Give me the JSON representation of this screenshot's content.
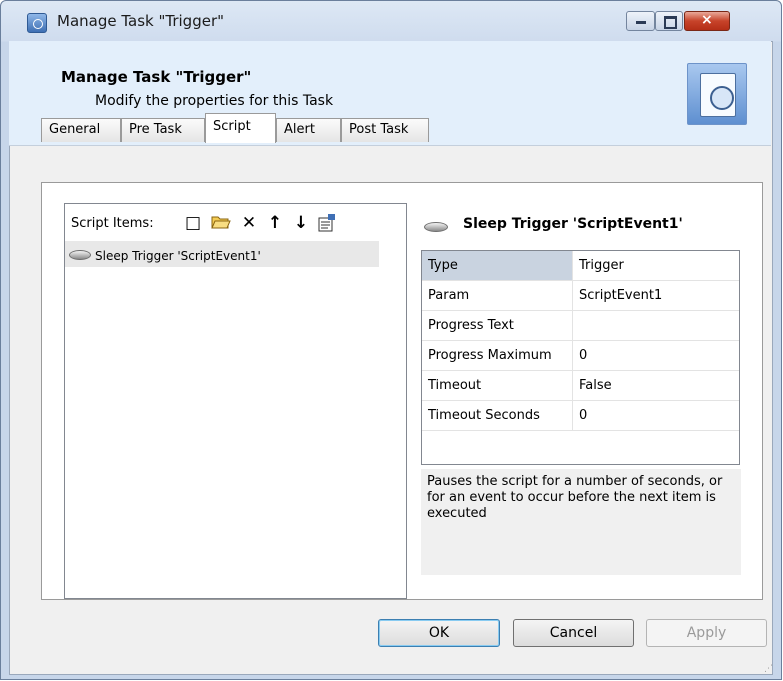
{
  "window": {
    "title": "Manage Task \"Trigger\"",
    "buttons": {
      "minimize": "minimize",
      "maximize": "maximize",
      "close": "×"
    }
  },
  "header": {
    "title": "Manage Task \"Trigger\"",
    "subtitle": "Modify the properties for this Task",
    "icon": "task-clock-icon"
  },
  "tabs": [
    {
      "label": "General",
      "active": false
    },
    {
      "label": "Pre Task",
      "active": false
    },
    {
      "label": "Script",
      "active": true
    },
    {
      "label": "Alert",
      "active": false
    },
    {
      "label": "Post Task",
      "active": false
    }
  ],
  "script_items": {
    "label": "Script Items:",
    "toolbar": {
      "new": "□",
      "open": "📂",
      "delete": "✕",
      "move_up": "↑",
      "move_down": "↓",
      "properties": "properties-icon"
    },
    "items": [
      {
        "text": "Sleep Trigger 'ScriptEvent1'",
        "selected": true
      }
    ]
  },
  "details": {
    "title": "Sleep Trigger 'ScriptEvent1'",
    "properties": [
      {
        "name": "Type",
        "value": "Trigger"
      },
      {
        "name": "Param",
        "value": "ScriptEvent1"
      },
      {
        "name": "Progress Text",
        "value": ""
      },
      {
        "name": "Progress Maximum",
        "value": "0"
      },
      {
        "name": "Timeout",
        "value": "False"
      },
      {
        "name": "Timeout Seconds",
        "value": "0"
      }
    ],
    "description": "Pauses the script for a number of seconds, or for an event to occur before the next item is executed"
  },
  "buttons": {
    "ok": "OK",
    "cancel": "Cancel",
    "apply": "Apply"
  }
}
